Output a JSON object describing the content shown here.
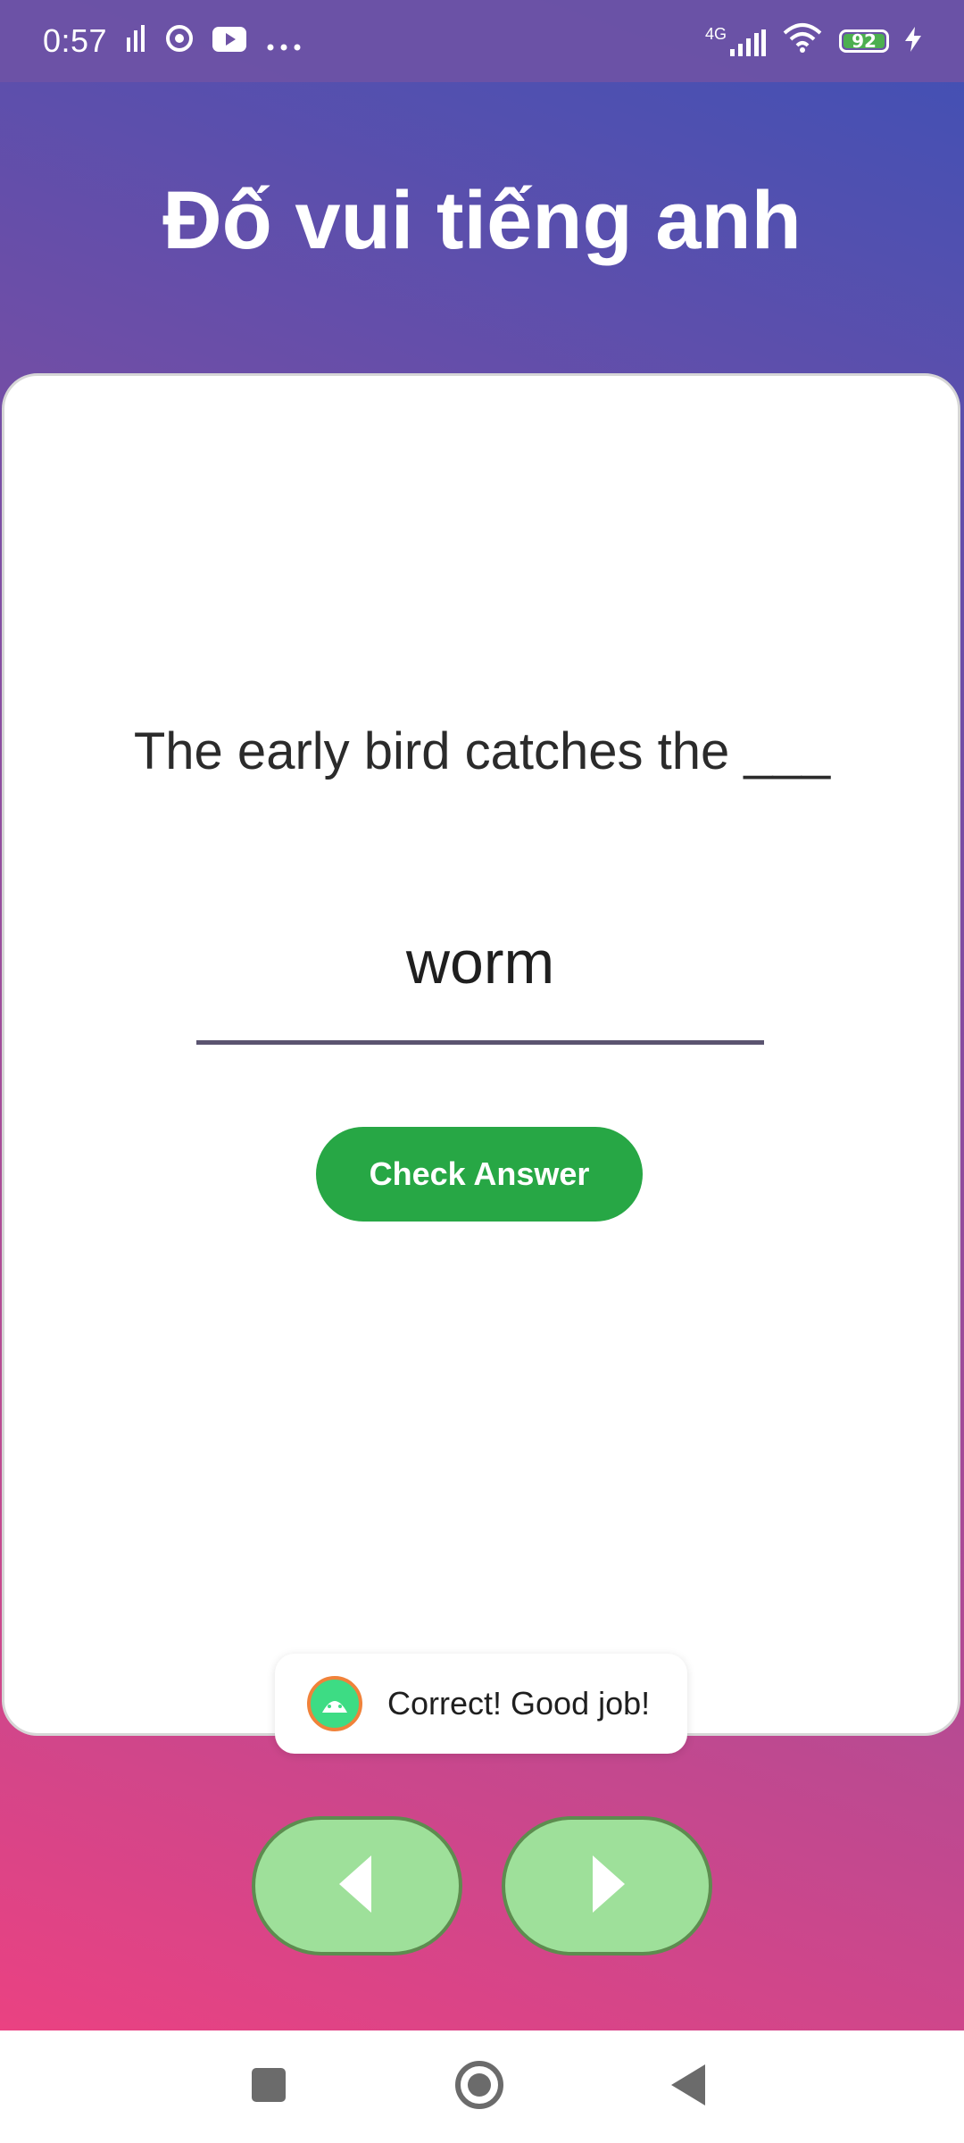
{
  "status_bar": {
    "time": "0:57",
    "network": "4G",
    "battery": "92",
    "icons": [
      "signal-bars-icon",
      "chrome-icon",
      "youtube-icon",
      "more-dots-icon",
      "cell-signal-icon",
      "wifi-icon",
      "battery-icon",
      "charging-bolt-icon"
    ]
  },
  "app": {
    "title": "Đố vui tiếng anh",
    "question": "The early bird catches the ___",
    "answer_value": "worm",
    "check_button_label": "Check Answer",
    "toast_message": "Correct! Good job!"
  },
  "navigation": {
    "prev_icon": "chevron-left-icon",
    "next_icon": "chevron-right-icon"
  },
  "system_nav": {
    "icons": [
      "recents-square-icon",
      "home-circle-icon",
      "back-triangle-icon"
    ]
  },
  "colors": {
    "check_button": "#27a745",
    "nav_button_fill": "#9ee09a",
    "battery_fill": "#4caf50"
  }
}
